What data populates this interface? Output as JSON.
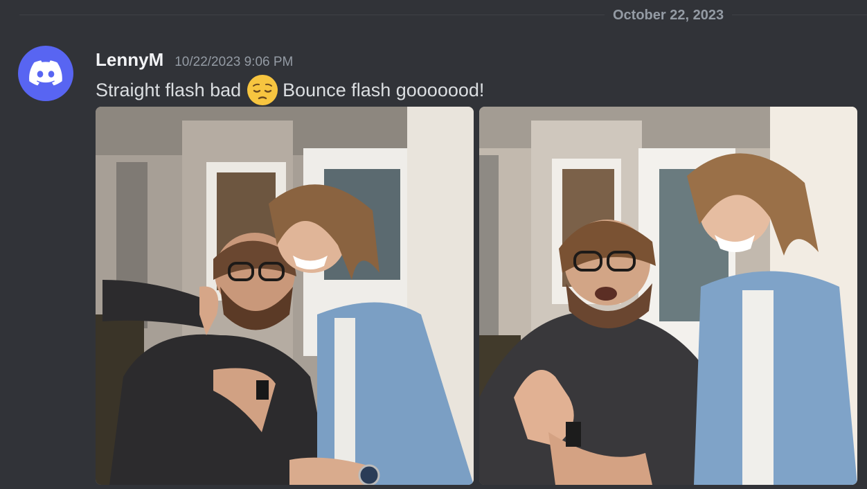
{
  "divider": {
    "date": "October 22, 2023"
  },
  "message": {
    "avatar_icon": "discord-logo-icon",
    "avatar_color": "#5865f2",
    "username": "LennyM",
    "timestamp": "10/22/2023 9:06 PM",
    "text_before": "Straight flash bad",
    "emoji": "pensive-face-emoji",
    "text_after": "Bounce flash gooooood!"
  },
  "attachments": [
    {
      "kind": "photo",
      "subject": "straight-flash-photo"
    },
    {
      "kind": "photo",
      "subject": "bounce-flash-photo"
    }
  ]
}
